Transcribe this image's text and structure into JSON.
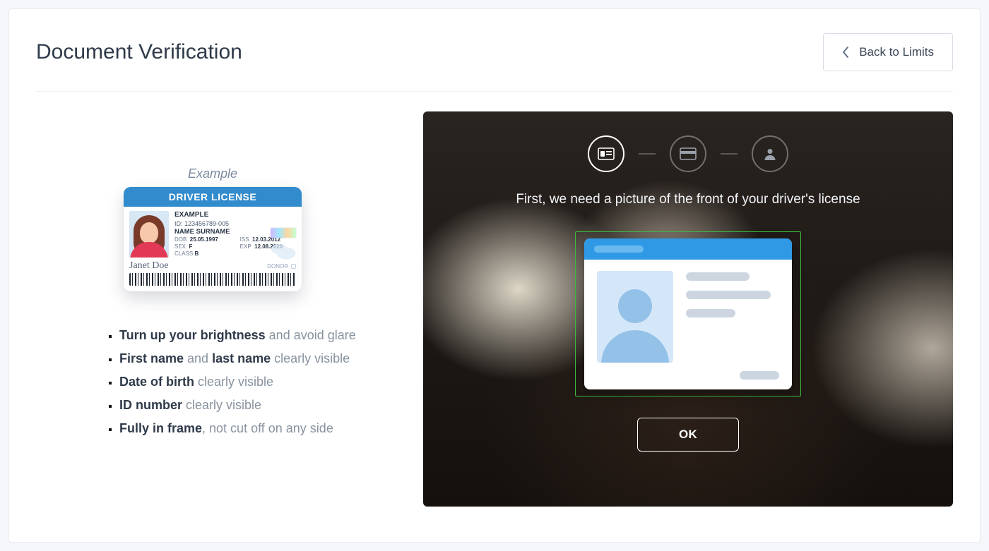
{
  "header": {
    "title": "Document Verification",
    "back_label": "Back to Limits"
  },
  "example": {
    "caption": "Example",
    "card": {
      "title": "DRIVER LICENSE",
      "example_label": "EXAMPLE",
      "id_line": "ID: 123456789-005",
      "name_line": "NAME SURNAME",
      "dob_label": "DOB",
      "dob_value": "25.05.1997",
      "iss_label": "ISS",
      "iss_value": "12.03.2012",
      "sex_label": "SEX",
      "sex_value": "F",
      "exp_label": "EXP",
      "exp_value": "12.08.2020",
      "class_label": "CLASS",
      "class_value": "B",
      "donor_label": "DONOR",
      "signature": "Janet Doe"
    }
  },
  "tips": [
    {
      "bold1": "Turn up your brightness",
      "rest1": " and avoid glare"
    },
    {
      "bold1": "First name",
      "mid": " and ",
      "bold2": "last name",
      "rest1": " clearly visible"
    },
    {
      "bold1": "Date of birth",
      "rest1": " clearly visible"
    },
    {
      "bold1": "ID number",
      "rest1": " clearly visible"
    },
    {
      "bold1": "Fully in frame",
      "rest1": ", not cut off on any side"
    }
  ],
  "camera": {
    "instruction": "First, we need a picture of the front of your driver's license",
    "ok_label": "OK",
    "steps": [
      {
        "icon": "id-front-icon",
        "active": true
      },
      {
        "icon": "id-back-icon",
        "active": false
      },
      {
        "icon": "person-icon",
        "active": false
      }
    ]
  }
}
